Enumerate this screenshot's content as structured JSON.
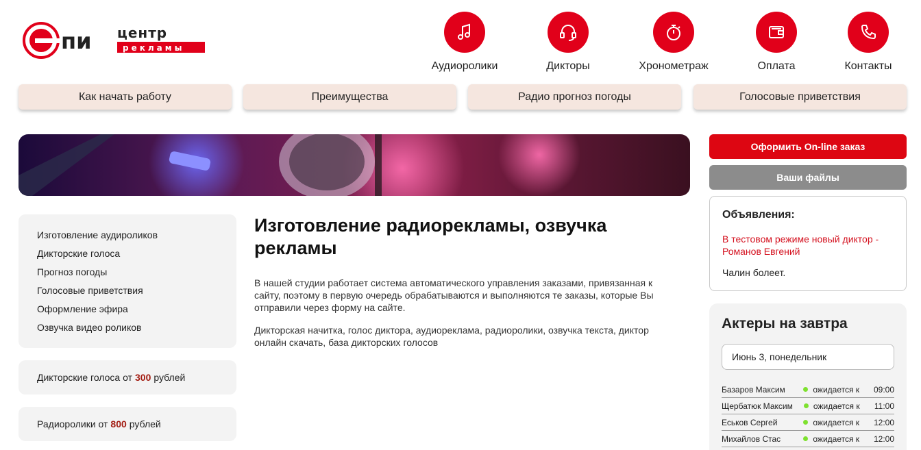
{
  "logo": {
    "part1": "пи",
    "part2": "центр",
    "part3": "рекламы"
  },
  "topnav": [
    {
      "label": "Аудиоролики",
      "icon": "music-note-icon"
    },
    {
      "label": "Дикторы",
      "icon": "headset-icon"
    },
    {
      "label": "Хронометраж",
      "icon": "stopwatch-icon"
    },
    {
      "label": "Оплата",
      "icon": "wallet-icon"
    },
    {
      "label": "Контакты",
      "icon": "phone-icon"
    }
  ],
  "tabs": [
    "Как начать работу",
    "Преимущества",
    "Радио прогноз погоды",
    "Голосовые приветствия"
  ],
  "sidebar": {
    "items": [
      "Изготовление аудироликов",
      "Дикторские голоса",
      "Прогноз погоды",
      "Голосовые приветствия",
      "Оформление эфира",
      "Озвучка видео роликов"
    ],
    "price1": {
      "before": "Дикторские голоса от",
      "value": "300",
      "after": "рублей"
    },
    "price2": {
      "before": "Радиоролики от",
      "value": "800",
      "after": "рублей"
    }
  },
  "main": {
    "title": "Изготовление радиорекламы, озвучка рекламы",
    "p1": "В нашей студии работает система автоматического управления заказами, привязанная к сайту, поэтому в первую очередь обрабатываются и выполняются те заказы, которые Вы отправили через форму на сайте.",
    "p2": "Дикторская начитка, голос диктора, аудиореклама, радиоролики, озвучка текста, диктор онлайн скачать, база дикторских голосов"
  },
  "right": {
    "order_button": "Оформить On-line заказ",
    "files_button": "Ваши файлы",
    "ads": {
      "title": "Объявления:",
      "link": "В тестовом режиме новый диктор - Романов Евгений",
      "text": "Чалин болеет."
    },
    "actors": {
      "title": "Актеры на завтра",
      "date": "Июнь 3, понедельник",
      "rows": [
        {
          "name": "Базаров Максим",
          "status": "ожидается к",
          "time": "09:00"
        },
        {
          "name": "Щербатюк Максим",
          "status": "ожидается к",
          "time": "11:00"
        },
        {
          "name": "Еськов Сергей",
          "status": "ожидается к",
          "time": "12:00"
        },
        {
          "name": "Михайлов Стас",
          "status": "ожидается к",
          "time": "12:00"
        }
      ]
    }
  },
  "colors": {
    "accent": "#e1001a",
    "tab_bg": "#f5e6df",
    "price": "#a31c12",
    "online_dot": "#7ee12f"
  }
}
